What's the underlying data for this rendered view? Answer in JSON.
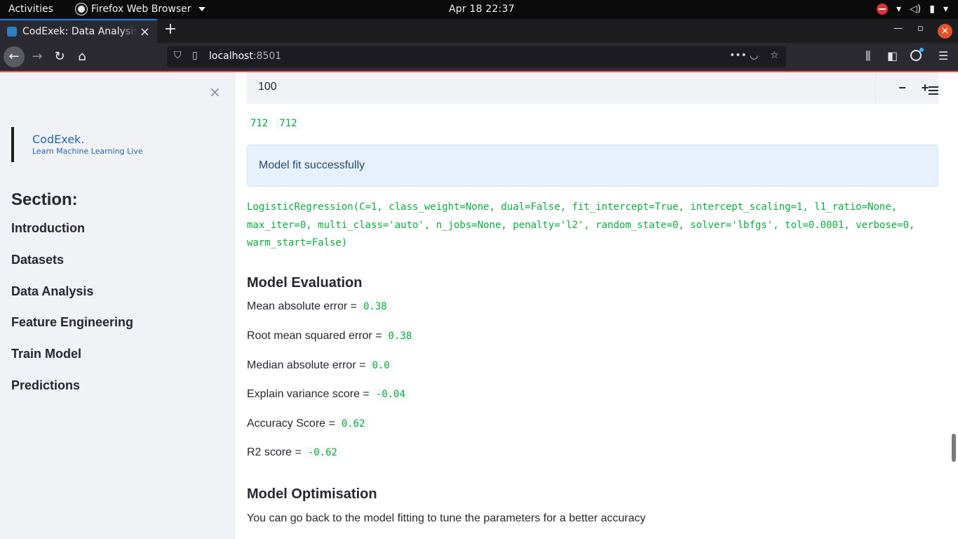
{
  "system_bar": {
    "activities": "Activities",
    "app_menu": "Firefox Web Browser",
    "clock": "Apr 18  22:37"
  },
  "browser": {
    "tab_title": "CodExek: Data Analysis a",
    "url_host": "localhost",
    "url_port": ":8501"
  },
  "sidebar": {
    "brand_name": "CodExek.",
    "brand_tagline": "Learn Machine Learning Live",
    "section_heading": "Section:",
    "items": [
      {
        "label": "Introduction"
      },
      {
        "label": "Datasets"
      },
      {
        "label": "Data Analysis"
      },
      {
        "label": "Feature Engineering"
      },
      {
        "label": "Train Model"
      },
      {
        "label": "Predictions"
      }
    ]
  },
  "main": {
    "number_input_value": "100",
    "decrement_label": "−",
    "increment_label": "+",
    "counts": [
      "712",
      "712"
    ],
    "success_message": "Model fit successfully",
    "model_repr": "LogisticRegression(C=1, class_weight=None, dual=False, fit_intercept=True, intercept_scaling=1, l1_ratio=None, max_iter=0, multi_class='auto', n_jobs=None, penalty='l2', random_state=0, solver='lbfgs', tol=0.0001, verbose=0, warm_start=False)",
    "evaluation_heading": "Model Evaluation",
    "metrics": [
      {
        "label": "Mean absolute error =",
        "value": "0.38"
      },
      {
        "label": "Root mean squared error =",
        "value": "0.38"
      },
      {
        "label": "Median absolute error =",
        "value": "0.0"
      },
      {
        "label": "Explain variance score =",
        "value": "-0.04"
      },
      {
        "label": "Accuracy Score =",
        "value": "0.62"
      },
      {
        "label": "R2 score =",
        "value": "-0.62"
      }
    ],
    "optimisation_heading": "Model Optimisation",
    "optimisation_text": "You can go back to the model fitting to tune the parameters for a better accuracy"
  }
}
